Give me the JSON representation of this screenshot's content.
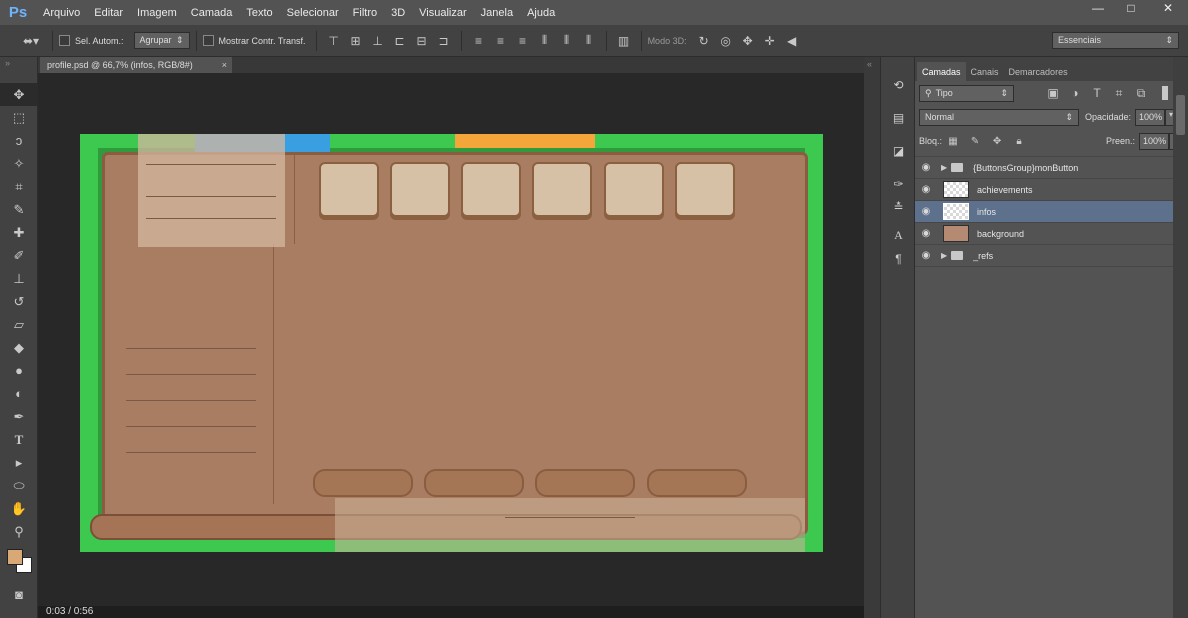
{
  "app": {
    "logo": "Ps",
    "menu": [
      "Arquivo",
      "Editar",
      "Imagem",
      "Camada",
      "Texto",
      "Selecionar",
      "Filtro",
      "3D",
      "Visualizar",
      "Janela",
      "Ajuda"
    ],
    "window_controls": [
      "—",
      "□",
      "✕"
    ]
  },
  "options_bar": {
    "auto_select_label": "Sel. Autom.:",
    "auto_select_value": "Agrupar",
    "show_transform_label": "Mostrar Contr. Transf.",
    "mode_3d_label": "Modo 3D:",
    "workspace": "Essenciais"
  },
  "document": {
    "tab_title": "profile.psd @ 66,7% (infos, RGB/8#)",
    "close": "×"
  },
  "layers_panel": {
    "tabs": [
      "Camadas",
      "Canais",
      "Demarcadores"
    ],
    "filter_label": "Tipo",
    "blend_mode": "Normal",
    "opacity_label": "Opacidade:",
    "opacity_value": "100%",
    "lock_label": "Bloq.:",
    "fill_label": "Preen.:",
    "fill_value": "100%",
    "layers": [
      {
        "name": "{ButtonsGroup}monButton",
        "kind": "folder"
      },
      {
        "name": "achievements",
        "kind": "layer"
      },
      {
        "name": "infos",
        "kind": "layer",
        "selected": true
      },
      {
        "name": "background",
        "kind": "layer-bg"
      },
      {
        "name": "_refs",
        "kind": "folder"
      }
    ]
  },
  "video": {
    "time": "0:03 / 0:56"
  },
  "colors": {
    "foreground": "#d9a877",
    "background": "#ffffff"
  }
}
